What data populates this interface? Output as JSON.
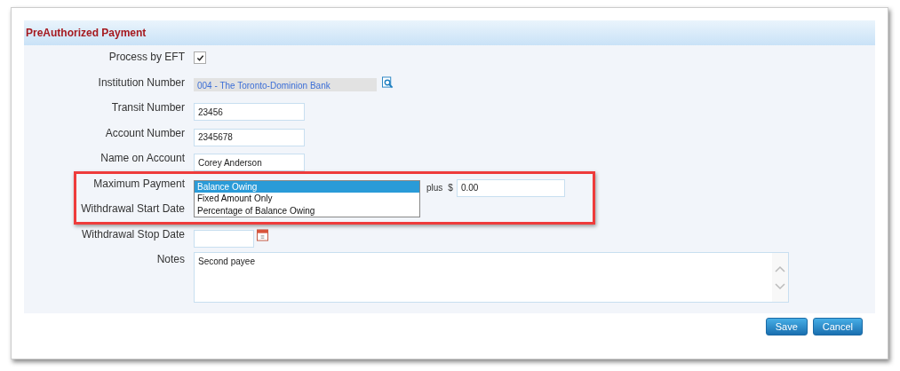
{
  "panel": {
    "title": "PreAuthorized Payment"
  },
  "fields": [
    {
      "kind": "checkbox",
      "label": "Process by EFT",
      "checked": true
    },
    {
      "kind": "lookup",
      "label": "Institution Number",
      "value": "004 - The Toronto-Dominion Bank"
    },
    {
      "kind": "text",
      "label": "Transit Number",
      "value": "23456"
    },
    {
      "kind": "text",
      "label": "Account Number",
      "value": "2345678"
    },
    {
      "kind": "text",
      "label": "Name on Account",
      "value": "Corey Anderson"
    },
    {
      "kind": "dropdown",
      "label": "Maximum Payment",
      "options": [
        {
          "label": "Balance Owing",
          "selected": true
        },
        {
          "label": "Fixed Amount Only",
          "selected": false
        },
        {
          "label": "Percentage of Balance Owing",
          "selected": false
        }
      ],
      "extra_label": "plus",
      "currency": "$",
      "amount": "0.00"
    },
    {
      "kind": "covered",
      "label": "Withdrawal Start Date"
    },
    {
      "kind": "date",
      "label": "Withdrawal Stop Date"
    },
    {
      "kind": "notes",
      "label": "Notes",
      "value": "Second payee"
    }
  ],
  "highlight": true,
  "buttons": [
    "Save",
    "Cancel"
  ]
}
